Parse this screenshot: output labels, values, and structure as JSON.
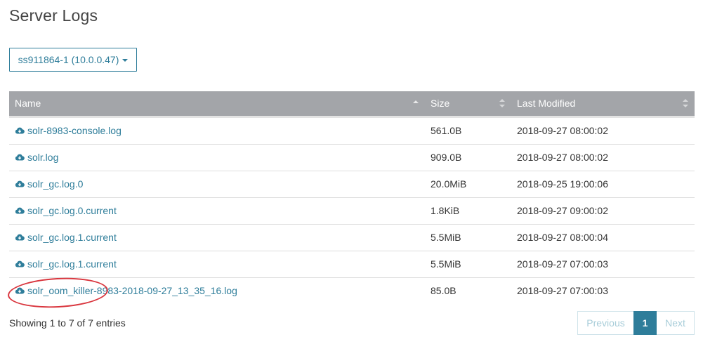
{
  "page": {
    "title": "Server Logs"
  },
  "server_select": {
    "value": "ss911864-1 (10.0.0.47)"
  },
  "table": {
    "headers": {
      "name": "Name",
      "size": "Size",
      "modified": "Last Modified"
    },
    "rows": [
      {
        "name": "solr-8983-console.log",
        "size": "561.0B",
        "modified": "2018-09-27 08:00:02"
      },
      {
        "name": "solr.log",
        "size": "909.0B",
        "modified": "2018-09-27 08:00:02"
      },
      {
        "name": "solr_gc.log.0",
        "size": "20.0MiB",
        "modified": "2018-09-25 19:00:06"
      },
      {
        "name": "solr_gc.log.0.current",
        "size": "1.8KiB",
        "modified": "2018-09-27 09:00:02"
      },
      {
        "name": "solr_gc.log.1.current",
        "size": "5.5MiB",
        "modified": "2018-09-27 08:00:04"
      },
      {
        "name": "solr_gc.log.1.current",
        "size": "5.5MiB",
        "modified": "2018-09-27 07:00:03"
      },
      {
        "name": "solr_oom_killer-8983-2018-09-27_13_35_16.log",
        "size": "85.0B",
        "modified": "2018-09-27 07:00:03"
      }
    ]
  },
  "footer": {
    "entries_info": "Showing 1 to 7 of 7 entries",
    "pagination": {
      "previous": "Previous",
      "current": "1",
      "next": "Next"
    }
  },
  "icons": {
    "download": "cloud-download-icon"
  },
  "colors": {
    "accent": "#2e7d9a",
    "header_bg": "#a3a5a9",
    "highlight_circle": "#d9363e"
  }
}
